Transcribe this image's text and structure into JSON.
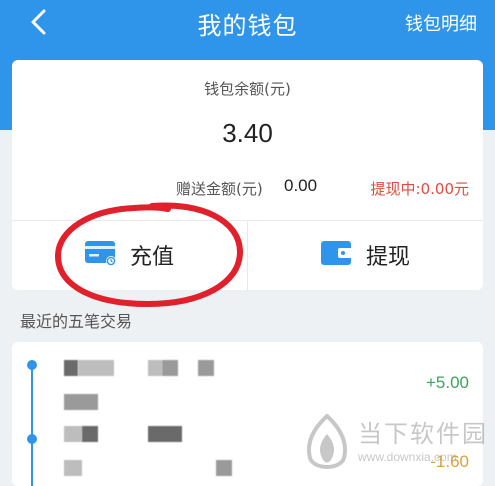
{
  "header": {
    "back_icon": "chevron-left-icon",
    "title": "我的钱包",
    "detail_link": "钱包明细",
    "color": "#2f95ea"
  },
  "wallet": {
    "balance_label": "钱包余额(元)",
    "balance_value": "3.40",
    "gift_label": "赠送金额(元)",
    "gift_value": "0.00",
    "withdrawing": "提现中:0.00元",
    "withdrawing_color": "#e04a3f"
  },
  "actions": {
    "recharge": {
      "label": "充值",
      "icon": "credit-card-icon"
    },
    "withdraw": {
      "label": "提现",
      "icon": "wallet-icon"
    }
  },
  "transactions": {
    "title": "最近的五笔交易",
    "items": [
      {
        "amount": "+5.00",
        "type": "income",
        "color": "#3ba55c"
      },
      {
        "amount": "-1.60",
        "type": "expense",
        "color": "#d9a23a"
      }
    ]
  },
  "watermark": {
    "text": "当下软件园",
    "url": "www.downxia.com"
  }
}
